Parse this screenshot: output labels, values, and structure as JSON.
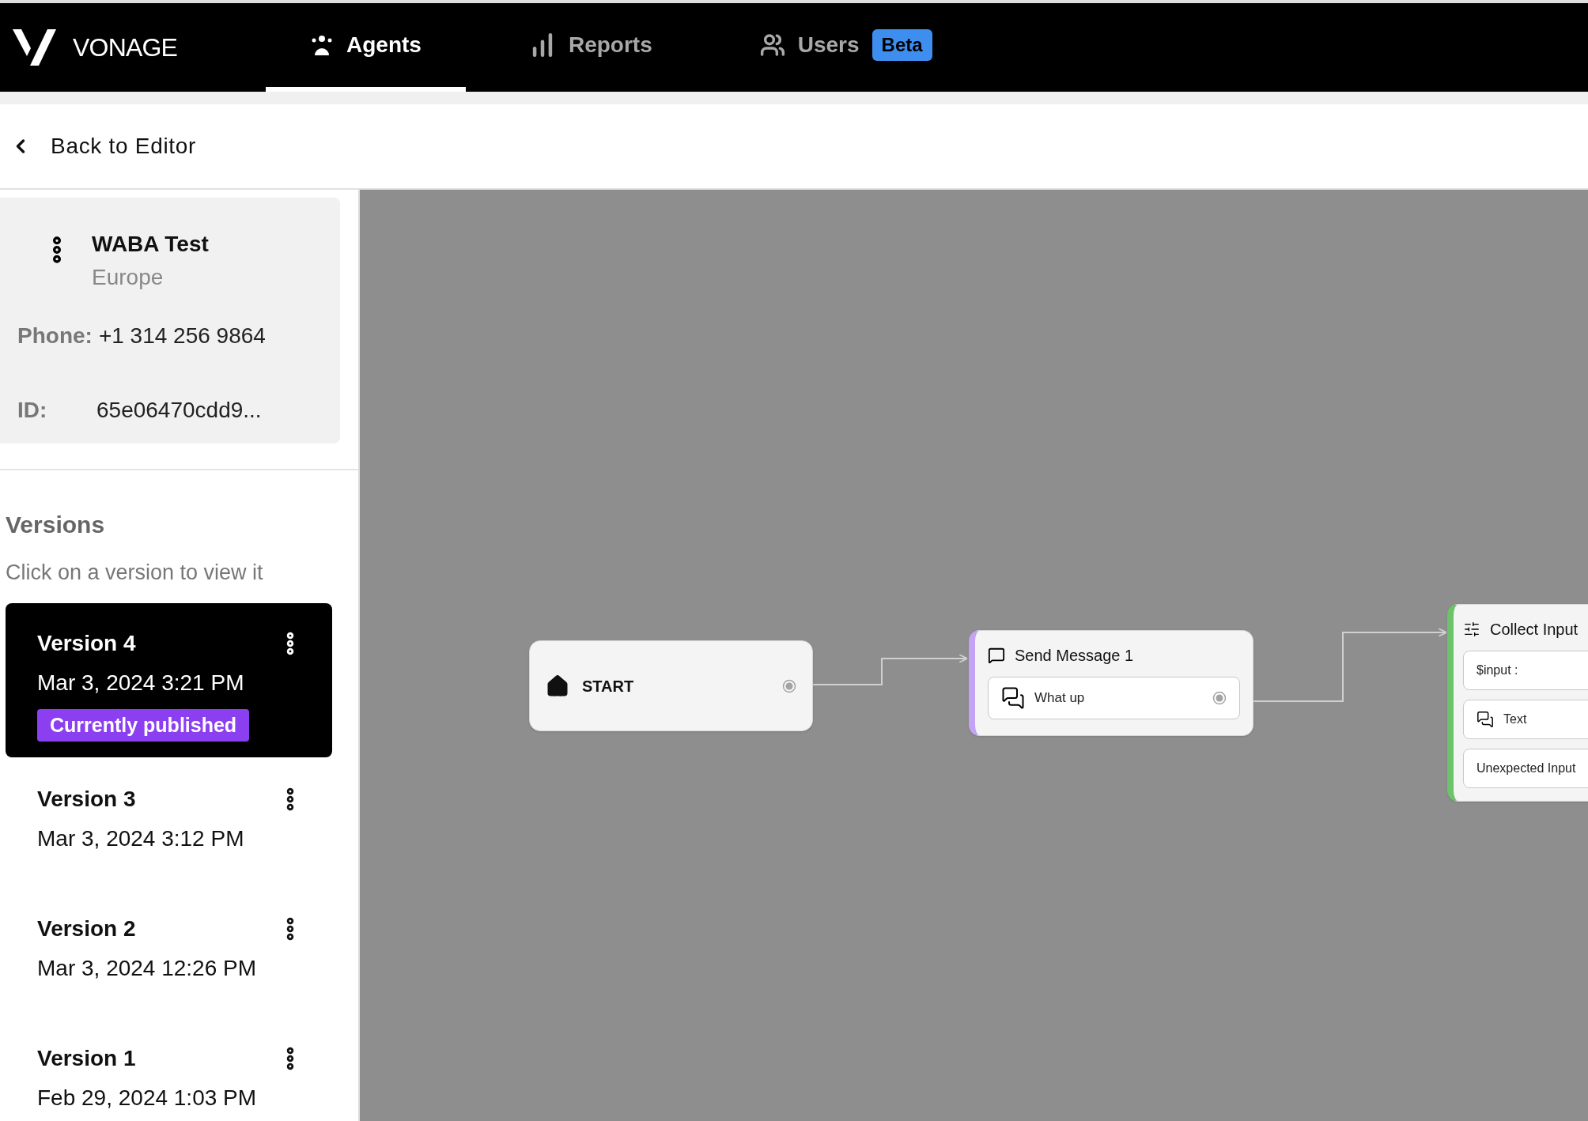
{
  "header": {
    "brand": "VONAGE",
    "tabs": [
      {
        "label": "Agents",
        "selected": true
      },
      {
        "label": "Reports",
        "selected": false
      },
      {
        "label": "Users",
        "selected": false,
        "badge": "Beta"
      }
    ]
  },
  "back_link": "Back to Editor",
  "agent": {
    "name": "WABA Test",
    "region": "Europe",
    "phone_label": "Phone:",
    "phone": "+1 314 256 9864",
    "id_label": "ID:",
    "id": "65e06470cdd9..."
  },
  "versions": {
    "title": "Versions",
    "hint": "Click on a version to view it",
    "items": [
      {
        "name": "Version 4",
        "date": "Mar 3, 2024 3:21 PM",
        "selected": true,
        "badge": "Currently published"
      },
      {
        "name": "Version 3",
        "date": "Mar 3, 2024 3:12 PM",
        "selected": false
      },
      {
        "name": "Version 2",
        "date": "Mar 3, 2024 12:26 PM",
        "selected": false
      },
      {
        "name": "Version 1",
        "date": "Feb 29, 2024 1:03 PM",
        "selected": false
      }
    ]
  },
  "canvas": {
    "nodes": [
      {
        "kind": "start",
        "title": "START"
      },
      {
        "kind": "message",
        "title": "Send Message 1",
        "color": "#c4a3f5",
        "message": "What up"
      },
      {
        "kind": "input",
        "title": "Collect Input",
        "color": "#6cc36a",
        "rows": [
          "$input :",
          "Text",
          "Unexpected Input"
        ]
      }
    ]
  }
}
